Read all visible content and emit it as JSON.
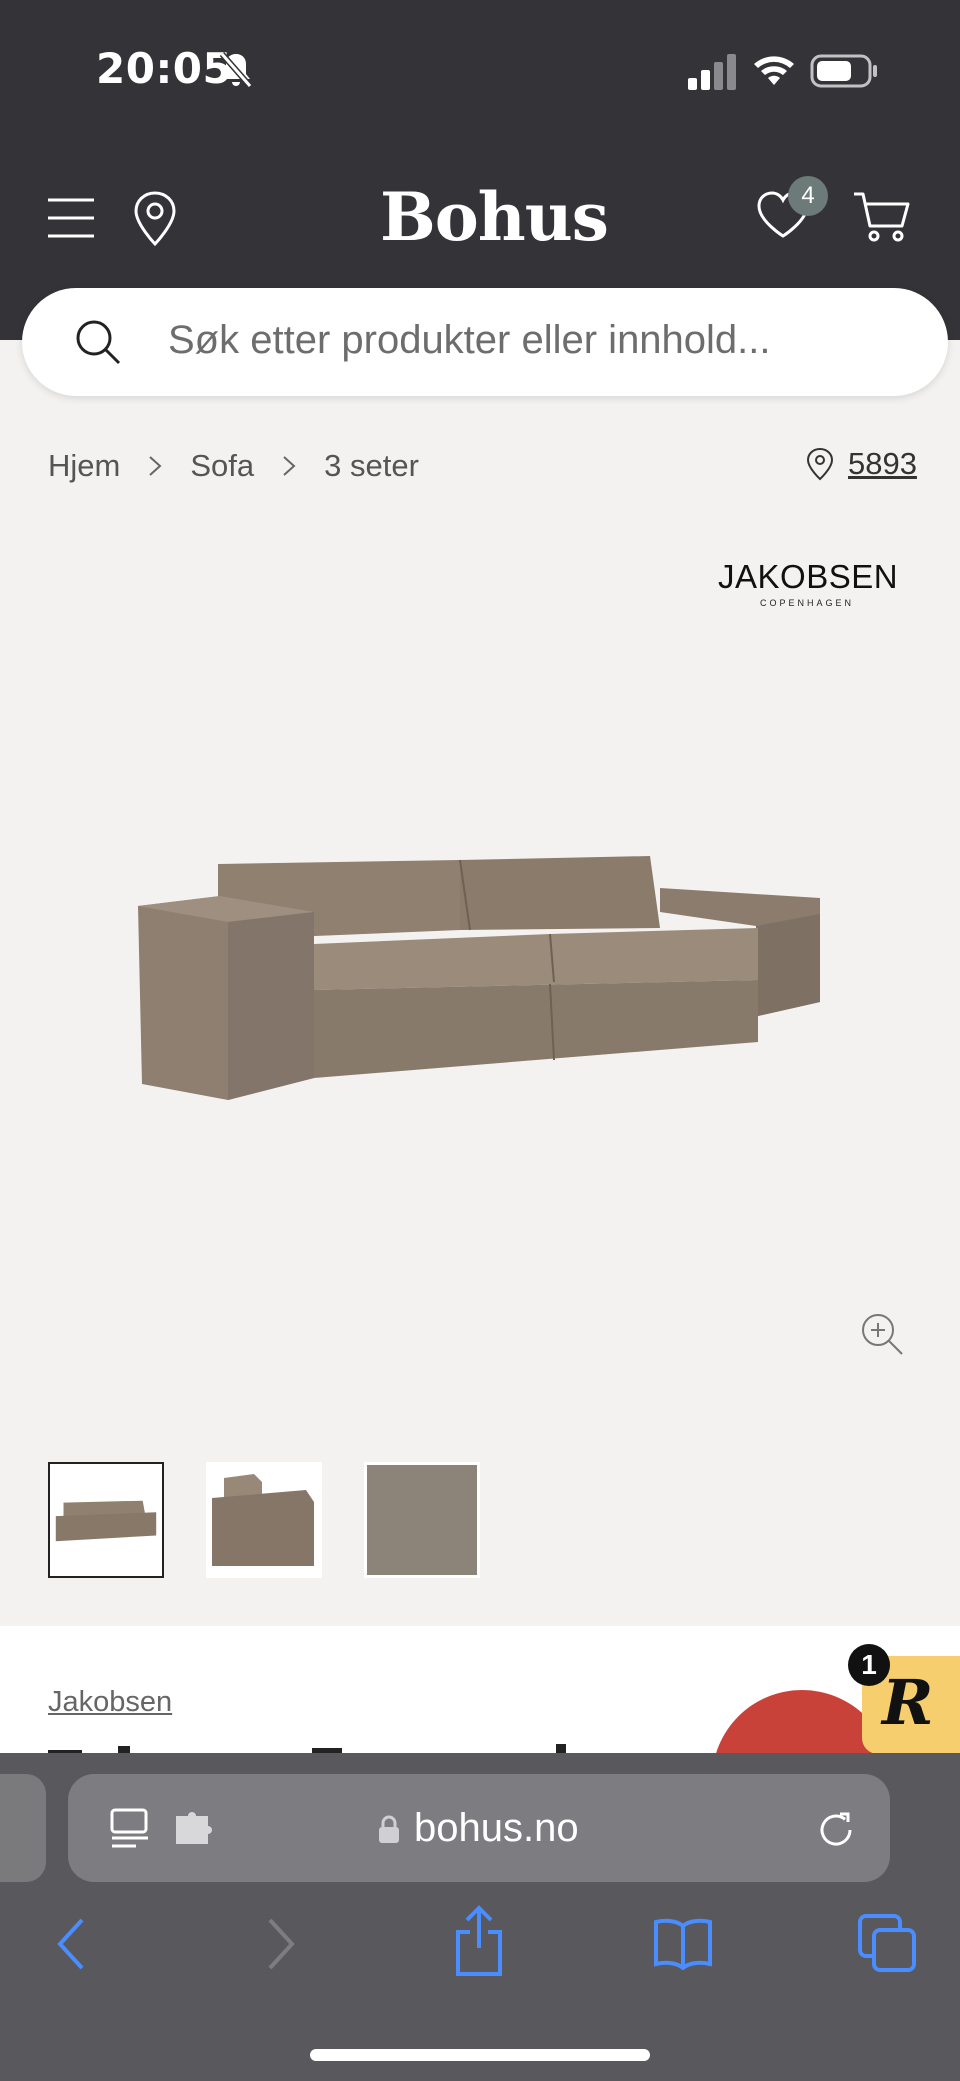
{
  "status_bar": {
    "time": "20:05"
  },
  "header": {
    "logo": "Bohus",
    "wishlist_count": "4"
  },
  "search": {
    "placeholder": "Søk etter produkter eller innhold..."
  },
  "breadcrumb": {
    "items": [
      "Hjem",
      "Sofa",
      "3 seter"
    ]
  },
  "store": {
    "number": "5893"
  },
  "brand": {
    "logo_name": "JAKOBSEN",
    "logo_sub": "COPENHAGEN",
    "link": "Jakobsen"
  },
  "widget": {
    "letter": "R",
    "badge": "1"
  },
  "browser": {
    "url": "bohus.no"
  },
  "colors": {
    "header_bg": "#343338",
    "page_bg": "#f4f2f0",
    "badge": "#6d7b78",
    "sofa": "#8a7b6d",
    "widget": "#f6ce6e",
    "bubble": "#c9423a",
    "safari_blue": "#3b82f6"
  }
}
